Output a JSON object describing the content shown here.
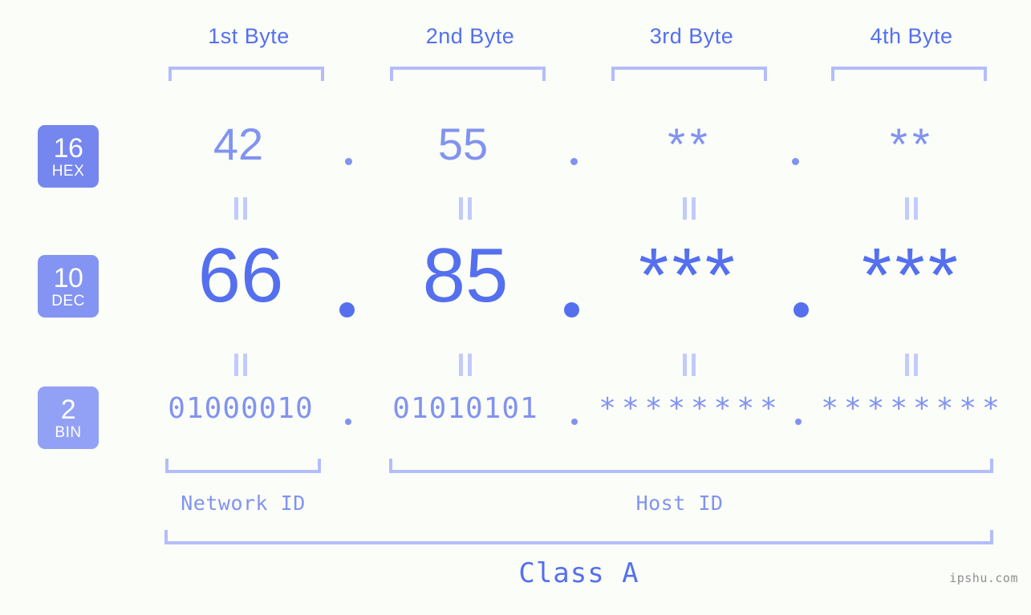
{
  "background_color": "#fbfdf8",
  "accent_colors": {
    "strong_blue": "#5470ee",
    "mid_blue": "#8193f0",
    "light_blue": "#b3bdfb",
    "eq_blue": "#c3cbfc",
    "badge_hex": "#7586ef",
    "badge_dec": "#8394f2",
    "badge_bin": "#92a1f5",
    "watermark_gray": "#8f8f8f"
  },
  "byte_headers": [
    {
      "label": "1st Byte"
    },
    {
      "label": "2nd Byte"
    },
    {
      "label": "3rd Byte"
    },
    {
      "label": "4th Byte"
    }
  ],
  "bases": [
    {
      "number": "16",
      "name": "HEX"
    },
    {
      "number": "10",
      "name": "DEC"
    },
    {
      "number": "2",
      "name": "BIN"
    }
  ],
  "rows": {
    "hex": {
      "values": [
        "42",
        "55",
        "**",
        "**"
      ]
    },
    "dec": {
      "values": [
        "66",
        "85",
        "***",
        "***"
      ]
    },
    "bin": {
      "values": [
        "01000010",
        "01010101",
        "********",
        "********"
      ]
    }
  },
  "separators": {
    "dot": ".",
    "equals": "="
  },
  "sections": [
    {
      "label": "Network ID"
    },
    {
      "label": "Host ID"
    }
  ],
  "class": {
    "label": "Class A"
  },
  "watermark": {
    "text": "ipshu.com"
  }
}
